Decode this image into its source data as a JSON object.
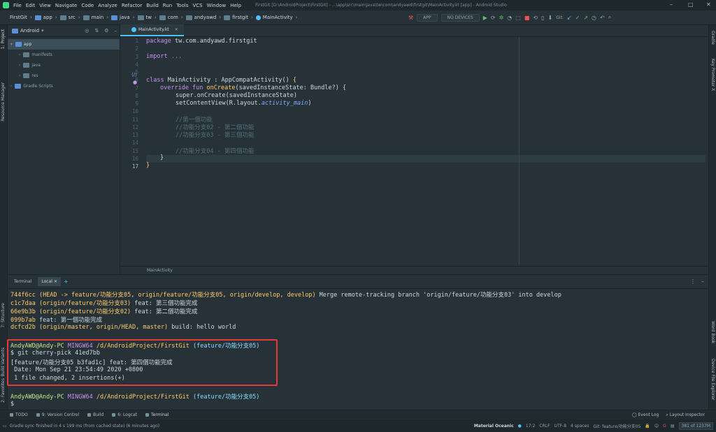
{
  "menu": {
    "items": [
      "File",
      "Edit",
      "View",
      "Navigate",
      "Code",
      "Analyze",
      "Refactor",
      "Build",
      "Run",
      "Tools",
      "VCS",
      "Window",
      "Help"
    ],
    "window_title": "FirstGit [D:\\AndroidProject\\FirstGit] - ...\\app\\src\\main\\java\\tw\\com\\andyawd\\firstgit\\MainActivity.kt [app] - Android Studio"
  },
  "breadcrumb": {
    "items": [
      "FirstGit",
      "app",
      "src",
      "main",
      "java",
      "tw",
      "com",
      "andyawd",
      "firstgit",
      "MainActivity"
    ]
  },
  "toolbar": {
    "run_config": "APP",
    "device": "NO DEVICES",
    "git_label": "Git:"
  },
  "left_strip": {
    "project": "1: Project",
    "resource_manager": "Resource Manager",
    "structure": "7: Structure",
    "build_variants": "Build Variants",
    "favorites": "2: Favorites"
  },
  "right_strip": {
    "gradle": "Gradle",
    "key_promoter": "Key Promoter X",
    "wordbook": "Word Book",
    "device_file_explorer": "Device File Explorer"
  },
  "project_panel": {
    "view": "Android",
    "tree": [
      {
        "label": "app",
        "level": 0,
        "selected": true
      },
      {
        "label": "manifests",
        "level": 1,
        "selected": false
      },
      {
        "label": "java",
        "level": 1,
        "selected": false
      },
      {
        "label": "res",
        "level": 1,
        "selected": false
      },
      {
        "label": "Gradle Scripts",
        "level": 0,
        "selected": false
      }
    ]
  },
  "editor": {
    "tab": "MainActivity.kt",
    "footer": "MainActivity",
    "line_numbers": [
      "1",
      "2",
      "3",
      "4",
      "5",
      "6",
      "7",
      "8",
      "9",
      "10",
      "11",
      "12",
      "13",
      "14",
      "15",
      "16",
      "17"
    ],
    "current_line": 17,
    "code": {
      "l1_kw": "package",
      "l1_rest": " tw.com.andyawd.firstgit",
      "l3_kw": "import",
      "l3_rest": " ...",
      "l6_kw": "class",
      "l6_rest": " MainActivity : AppCompatActivity() ",
      "l6_brace": "{",
      "l7_kw": "override fun",
      "l7_fn": " onCreate",
      "l7_rest": "(savedInstanceState: Bundle?) {",
      "l8": "super.onCreate(savedInstanceState)",
      "l9_a": "setContentView(R.layout.",
      "l9_b": "activity_main",
      "l9_c": ")",
      "l11": "//第一個功能",
      "l12": "//功能分支02 - 第二個功能",
      "l13": "//功能分支03 - 第三個功能",
      "l15": "//功能分支04 - 第四個功能",
      "l16": "}",
      "l17": "}"
    }
  },
  "terminal": {
    "title": "Terminal",
    "tab": "Local",
    "log": [
      {
        "hash": "744f6cc",
        "refs_open": " (HEAD -> ",
        "r1": "feature/功能分支05",
        "c1": ", ",
        "r2": "origin/feature/功能分支05",
        "c2": ", ",
        "r3": "origin/develop",
        "c3": ", ",
        "r4": "develop",
        "close": ")",
        "msg": " Merge remote-tracking branch 'origin/feature/功能分支03' into develop"
      },
      {
        "hash": "c1c7daa",
        "refs": " (origin/feature/功能分支03)",
        "msg": " feat: 第三個功能完成"
      },
      {
        "hash": "66e9b3b",
        "refs": " (origin/feature/功能分支02)",
        "msg": " feat: 第二個功能完成"
      },
      {
        "hash": "099b7ab",
        "msg": " feat: 第一個功能完成"
      },
      {
        "hash": "dcfcd2b",
        "refs": " (origin/master, origin/HEAD, master)",
        "msg": " build: hello world"
      }
    ],
    "prompt1": {
      "user": "AndyAWD@Andy-PC",
      "shell": " MINGW64",
      "path": " /d/AndroidProject/FirstGit",
      "branch": " (feature/功能分支05)"
    },
    "cmd": "$ git cherry-pick 41ed7bb",
    "out1": "[feature/功能分支05 b3fad1c] feat: 第四個功能完成",
    "out2": " Date: Mon Sep 21 23:54:49 2020 +0800",
    "out3": " 1 file changed, 2 insertions(+)",
    "prompt2": {
      "user": "AndyAWD@Andy-PC",
      "shell": " MINGW64",
      "path": " /d/AndroidProject/FirstGit",
      "branch": " (feature/功能分支05)"
    },
    "cursor": "$"
  },
  "tool_windows": {
    "todo": "TODO",
    "vcs": "9: Version Control",
    "build": "Build",
    "logcat": "6: Logcat",
    "terminal": "Terminal",
    "event_log": "Event Log",
    "layout_inspector": "Layout Inspector"
  },
  "status": {
    "message": "Gradle sync finished in 4 s 199 ms (from cached state) (6 minutes ago)",
    "theme": "Material Oceanic",
    "position": "17:2",
    "line_sep": "CRLF",
    "encoding": "UTF-8",
    "indent": "4 spaces",
    "git_branch": "Git: feature/功能分支05",
    "memory": "381 of 1237M"
  }
}
